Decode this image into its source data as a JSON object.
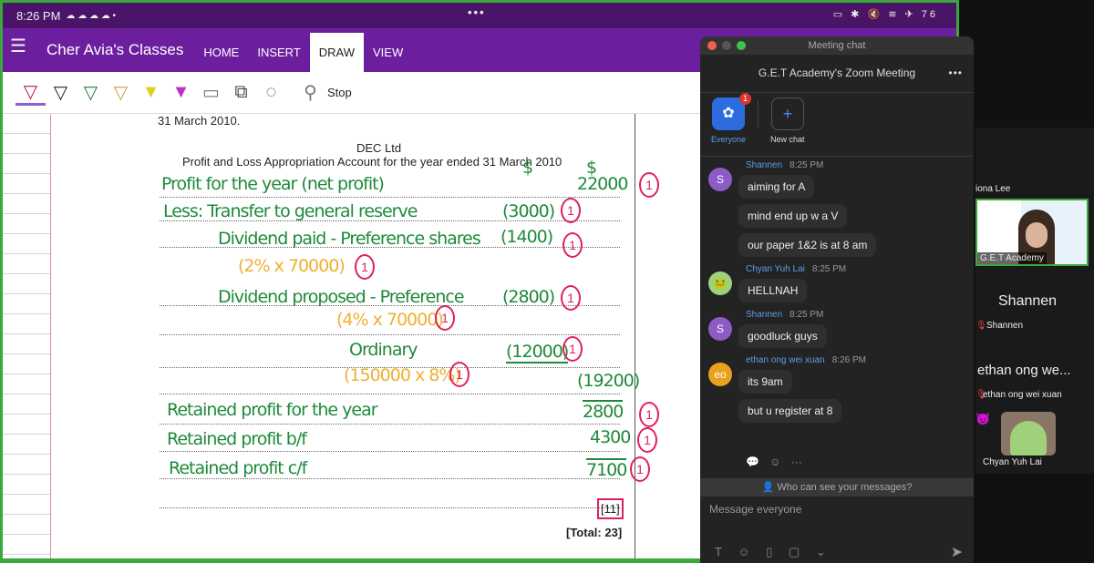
{
  "status": {
    "time": "8:26 PM",
    "icons": "☁ ☁ ☁ ☁ •",
    "right": "▭ ✱ 🔇 ≋ ✈ 76"
  },
  "nav": {
    "title": "Cher Avia's Classes",
    "tabs": [
      "HOME",
      "INSERT",
      "DRAW",
      "VIEW"
    ],
    "active": "DRAW"
  },
  "toolbar": {
    "stop": "Stop"
  },
  "doc": {
    "top": "31 March 2010.",
    "company": "DEC Ltd",
    "heading": "Profit and Loss Appropriation Account for the year ended 31 March 2010",
    "hw": [
      "Profit for the year (net profit)",
      "Less: Transfer to general reserve",
      "Dividend paid - Preference shares",
      "Dividend proposed - Preference",
      "Ordinary",
      "Retained profit for the year",
      "Retained profit b/f",
      "Retained profit c/f",
      "$",
      "$"
    ],
    "amounts": [
      "22000",
      "(3000)",
      "(1400)",
      "(2800)",
      "(12000)",
      "(19200)",
      "2800",
      "4300",
      "7100"
    ],
    "workings": [
      "(2% x 70000)",
      "(4% x 70000)",
      "(150000 x 8%)"
    ],
    "mark": "1",
    "subtotal": "[11]",
    "total": "[Total: 23]"
  },
  "chat": {
    "window_title": "Meeting chat",
    "meeting": "G.E.T Academy's Zoom Meeting",
    "more": "•••",
    "everyone": "Everyone",
    "badge": "1",
    "new_chat": "New chat",
    "groups": [
      {
        "name": "Shannen",
        "time": "8:25 PM",
        "initial": "S",
        "color": "#8e5bc6",
        "msgs": [
          "aiming for A",
          "mind end up w a V",
          "our paper 1&2 is at 8 am"
        ]
      },
      {
        "name": "Chyan Yuh Lai",
        "time": "8:25 PM",
        "initial": "🐸",
        "color": "#9fd17a",
        "msgs": [
          "HELLNAH"
        ]
      },
      {
        "name": "Shannen",
        "time": "8:25 PM",
        "initial": "S",
        "color": "#8e5bc6",
        "msgs": [
          "goodluck guys"
        ]
      },
      {
        "name": "ethan ong wei xuan",
        "time": "8:26 PM",
        "initial": "eo",
        "color": "#e8a21e",
        "msgs": [
          "its 9am",
          "but u register at 8"
        ]
      }
    ],
    "who": "Who can see your messages?",
    "placeholder": "Message everyone",
    "bar": "T ☺ ▯ ▢ ⌄",
    "send": "➤"
  },
  "participants": {
    "p0": "iona Lee",
    "video_label": "G.E.T Academy",
    "p1_big": "Shannen",
    "p1": "Shannen",
    "p2_big": "ethan ong we...",
    "p2": "ethan ong wei xuan",
    "p3": "Chyan Yuh Lai",
    "emoji": "😈"
  }
}
